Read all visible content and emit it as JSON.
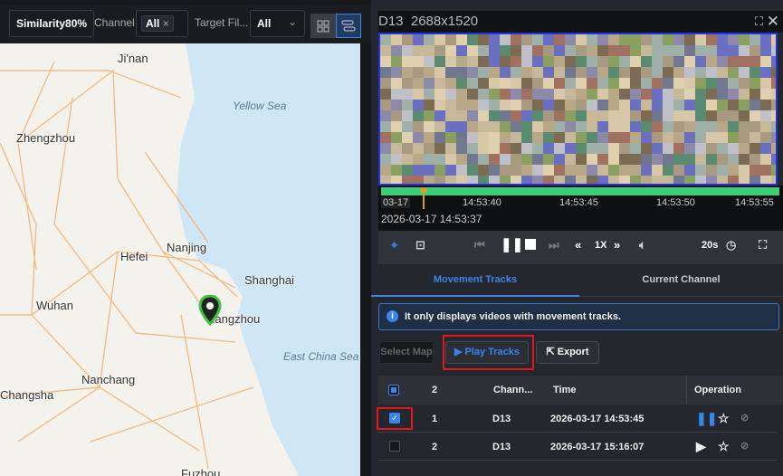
{
  "toolbar": {
    "similarity": "Similarity80%",
    "channel_label": "Channel",
    "channel_tag": "All",
    "target_label": "Target Fil...",
    "target_value": "All"
  },
  "map": {
    "cities": [
      "Ji'nan",
      "Zhengzhou",
      "Hefei",
      "Nanjing",
      "Shanghai",
      "Wuhan",
      "Hangzhou",
      "Nanchang",
      "Changsha",
      "Fuzhou"
    ],
    "seas": [
      "Yellow Sea",
      "East China Sea"
    ]
  },
  "player": {
    "title": "D13  2688x1520",
    "date_tag": "03-17",
    "ticks": [
      "14:53:40",
      "14:53:45",
      "14:53:50",
      "14:53:55"
    ],
    "current_time": "2026-03-17 14:53:37",
    "speed": "1X",
    "interval": "20s",
    "progress_color": "#3ccf7a"
  },
  "tabs": [
    {
      "label": "Movement Tracks",
      "active": true
    },
    {
      "label": "Current Channel",
      "active": false
    }
  ],
  "info": "It only displays videos with movement tracks.",
  "buttons": {
    "select_map": "Select Map",
    "play_tracks": "Play Tracks",
    "export": "Export"
  },
  "table": {
    "headers": {
      "count": "2",
      "channel": "Chann...",
      "time": "Time",
      "operation": "Operation"
    },
    "rows": [
      {
        "index": "1",
        "channel": "D13",
        "time": "2026-03-17 14:53:45",
        "checked": true,
        "playing": true
      },
      {
        "index": "2",
        "channel": "D13",
        "time": "2026-03-17 15:16:07",
        "checked": false,
        "playing": false
      }
    ]
  },
  "accent": "#3a86e8"
}
